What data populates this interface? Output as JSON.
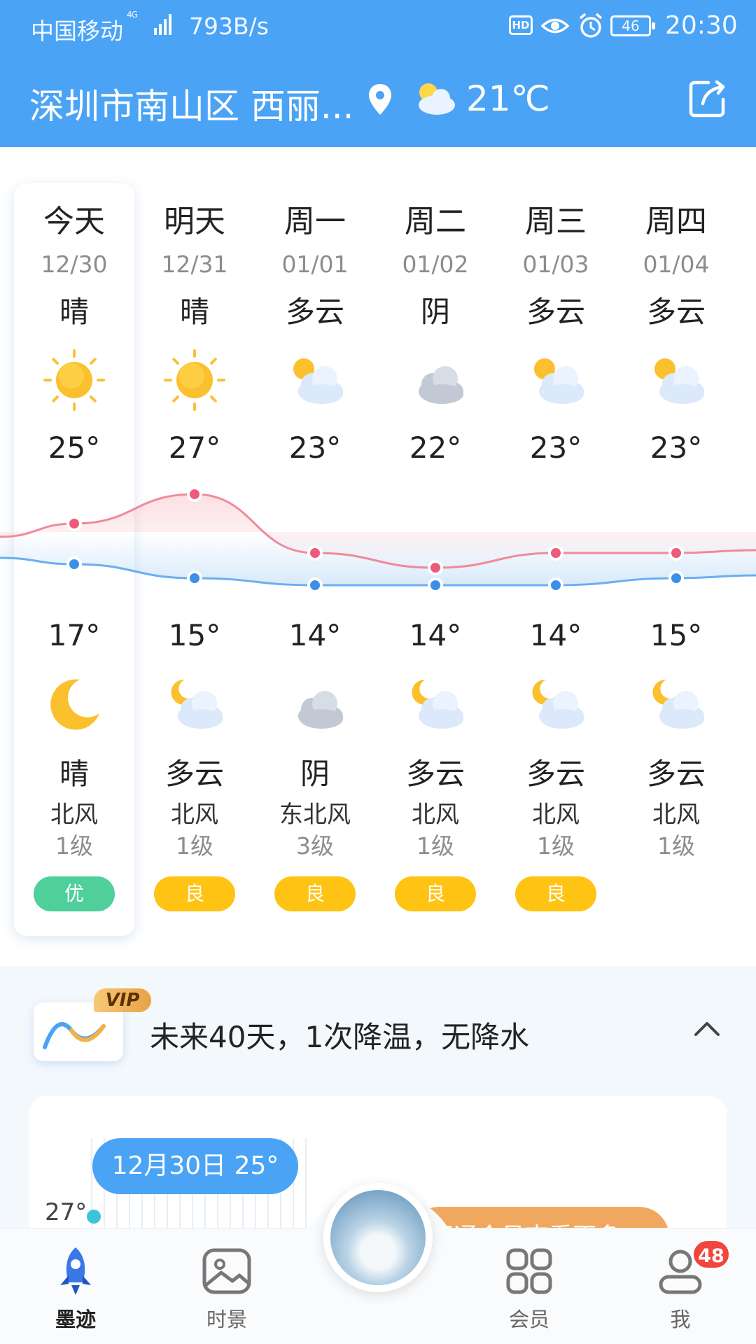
{
  "status_bar": {
    "carrier": "中国移动",
    "network": "4G",
    "speed": "793B/s",
    "battery": "46",
    "time": "20:30"
  },
  "header": {
    "location": "深圳市南山区 西丽...",
    "current_temp": "21℃",
    "current_icon": "partly-cloudy-icon"
  },
  "forecast": [
    {
      "day": "今天",
      "date": "12/30",
      "day_cond": "晴",
      "day_icon": "sun-icon",
      "high": "25°",
      "low": "17°",
      "night_icon": "moon-icon",
      "night_cond": "晴",
      "wind": "北风",
      "level": "1级",
      "aqi": "优",
      "aqi_color": "#4fcf9a"
    },
    {
      "day": "明天",
      "date": "12/31",
      "day_cond": "晴",
      "day_icon": "sun-icon",
      "high": "27°",
      "low": "15°",
      "night_icon": "moon-cloud-icon",
      "night_cond": "多云",
      "wind": "北风",
      "level": "1级",
      "aqi": "良",
      "aqi_color": "#ffc314"
    },
    {
      "day": "周一",
      "date": "01/01",
      "day_cond": "多云",
      "day_icon": "sun-cloud-icon",
      "high": "23°",
      "low": "14°",
      "night_icon": "overcast-icon",
      "night_cond": "阴",
      "wind": "东北风",
      "level": "3级",
      "aqi": "良",
      "aqi_color": "#ffc314"
    },
    {
      "day": "周二",
      "date": "01/02",
      "day_cond": "阴",
      "day_icon": "overcast-icon",
      "high": "22°",
      "low": "14°",
      "night_icon": "moon-cloud-icon",
      "night_cond": "多云",
      "wind": "北风",
      "level": "1级",
      "aqi": "良",
      "aqi_color": "#ffc314"
    },
    {
      "day": "周三",
      "date": "01/03",
      "day_cond": "多云",
      "day_icon": "sun-cloud-icon",
      "high": "23°",
      "low": "14°",
      "night_icon": "moon-cloud-icon",
      "night_cond": "多云",
      "wind": "北风",
      "level": "1级",
      "aqi": "良",
      "aqi_color": "#ffc314"
    },
    {
      "day": "周四",
      "date": "01/04",
      "day_cond": "多云",
      "day_icon": "sun-cloud-icon",
      "high": "23°",
      "low": "15°",
      "night_icon": "moon-cloud-icon",
      "night_cond": "多云",
      "wind": "北风",
      "level": "1级",
      "aqi": "",
      "aqi_color": ""
    }
  ],
  "colors": {
    "header_bg": "#4aa3f5",
    "high_line": "#f08a98",
    "low_line": "#6aaef0"
  },
  "vip": {
    "badge": "VIP",
    "summary": "未来40天，1次降温，无降水",
    "date_pill": "12月30日 25°",
    "temp_label": "27°",
    "promo": "开通会员查看更多"
  },
  "nav": [
    {
      "label": "墨迹",
      "icon": "rocket-icon",
      "active": true
    },
    {
      "label": "时景",
      "icon": "picture-icon",
      "active": false
    },
    {
      "label": "会员",
      "icon": "grid-icon",
      "active": false
    },
    {
      "label": "我",
      "icon": "user-icon",
      "active": false
    }
  ],
  "nav_badge": "48"
}
